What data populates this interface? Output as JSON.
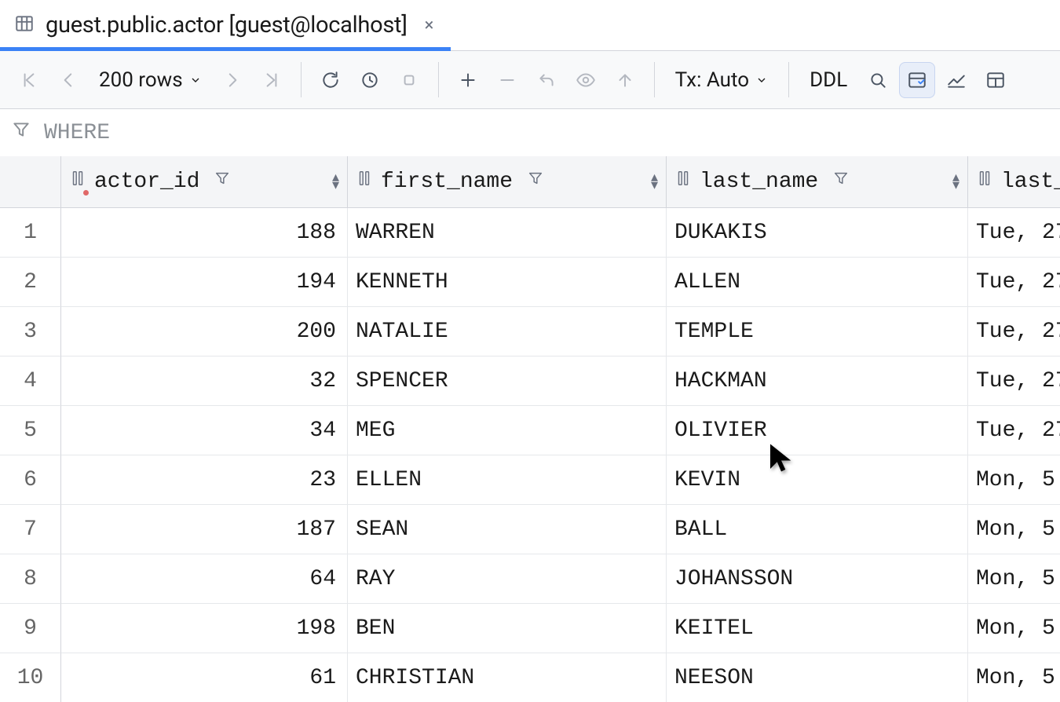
{
  "tab": {
    "title": "guest.public.actor [guest@localhost]",
    "close_glyph": "×"
  },
  "toolbar": {
    "rows_label": "200 rows",
    "tx_label": "Tx: Auto",
    "ddl_label": "DDL"
  },
  "filter": {
    "where_label": "WHERE"
  },
  "columns": [
    {
      "key": "actor_id",
      "label": "actor_id",
      "pk": true,
      "numeric": true
    },
    {
      "key": "first_name",
      "label": "first_name",
      "pk": false,
      "numeric": false
    },
    {
      "key": "last_name",
      "label": "last_name",
      "pk": false,
      "numeric": false
    },
    {
      "key": "last_update",
      "label": "last_",
      "pk": false,
      "numeric": false
    }
  ],
  "rows": [
    {
      "n": 1,
      "actor_id": 188,
      "first_name": "WARREN",
      "last_name": "DUKAKIS",
      "last_update": "Tue, 27"
    },
    {
      "n": 2,
      "actor_id": 194,
      "first_name": "KENNETH",
      "last_name": "ALLEN",
      "last_update": "Tue, 27"
    },
    {
      "n": 3,
      "actor_id": 200,
      "first_name": "NATALIE",
      "last_name": "TEMPLE",
      "last_update": "Tue, 27"
    },
    {
      "n": 4,
      "actor_id": 32,
      "first_name": "SPENCER",
      "last_name": "HACKMAN",
      "last_update": "Tue, 27"
    },
    {
      "n": 5,
      "actor_id": 34,
      "first_name": "MEG",
      "last_name": "OLIVIER",
      "last_update": "Tue, 27"
    },
    {
      "n": 6,
      "actor_id": 23,
      "first_name": "ELLEN",
      "last_name": "KEVIN",
      "last_update": "Mon, 5"
    },
    {
      "n": 7,
      "actor_id": 187,
      "first_name": "SEAN",
      "last_name": "BALL",
      "last_update": "Mon, 5"
    },
    {
      "n": 8,
      "actor_id": 64,
      "first_name": "RAY",
      "last_name": "JOHANSSON",
      "last_update": "Mon, 5"
    },
    {
      "n": 9,
      "actor_id": 198,
      "first_name": "BEN",
      "last_name": "KEITEL",
      "last_update": "Mon, 5"
    },
    {
      "n": 10,
      "actor_id": 61,
      "first_name": "CHRISTIAN",
      "last_name": "NEESON",
      "last_update": "Mon, 5"
    }
  ]
}
